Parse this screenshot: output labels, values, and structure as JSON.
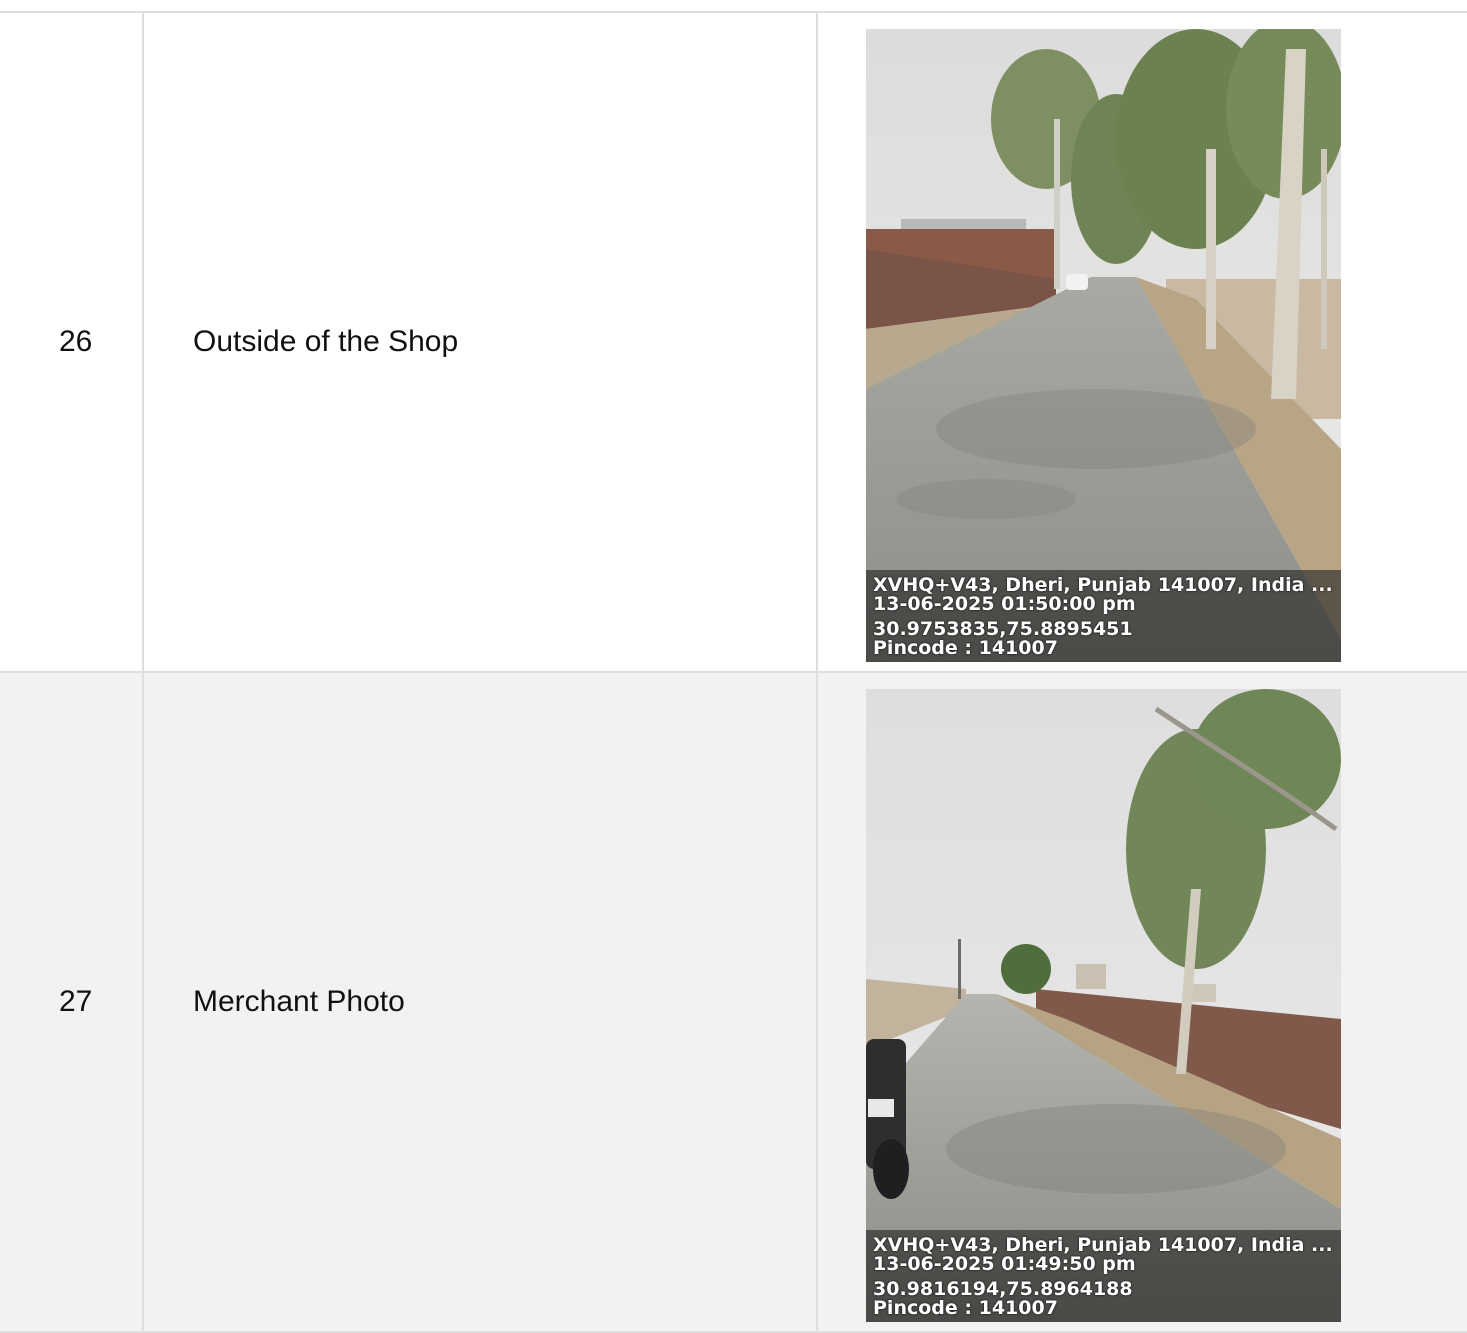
{
  "rows": [
    {
      "number": "26",
      "label": "Outside of the Shop",
      "photo": {
        "address": "XVHQ+V43, Dheri, Punjab 141007, India ...",
        "datetime": "13-06-2025 01:50:00 pm",
        "coords": "30.9753835,75.8895451",
        "pincode": "Pincode : 141007"
      }
    },
    {
      "number": "27",
      "label": "Merchant Photo",
      "photo": {
        "address": "XVHQ+V43, Dheri, Punjab 141007, India ...",
        "datetime": "13-06-2025 01:49:50 pm",
        "coords": "30.9816194,75.8964188",
        "pincode": "Pincode : 141007"
      }
    }
  ]
}
